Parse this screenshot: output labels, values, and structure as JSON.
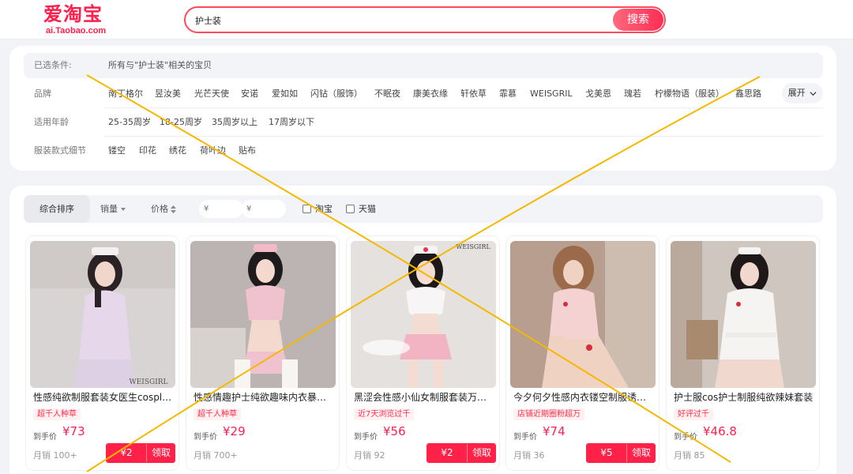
{
  "header": {
    "logo_main": "爱淘宝",
    "logo_sub": "ai.Taobao.com",
    "search_value": "护士装",
    "search_button": "搜索"
  },
  "filters": {
    "selected_label": "已选条件:",
    "selected_value": "所有与\"护士装\"相关的宝贝",
    "brand_label": "品牌",
    "brands": [
      "南丁格尔",
      "昱汝美",
      "光芒天使",
      "安诺",
      "爱如如",
      "闪钻（服饰）",
      "不眠夜",
      "康美衣缘",
      "轩依草",
      "霏慕",
      "WEISGRIL",
      "戈美恩",
      "瑰若",
      "柠檬物语（服装）",
      "鑫思路"
    ],
    "expand_label": "展开",
    "age_label": "适用年龄",
    "ages": [
      "25-35周岁",
      "18-25周岁",
      "35周岁以上",
      "17周岁以下"
    ],
    "detail_label": "服装款式细节",
    "details": [
      "镂空",
      "印花",
      "绣花",
      "荷叶边",
      "贴布"
    ]
  },
  "sort": {
    "comprehensive": "综合排序",
    "sales": "销量",
    "price": "价格",
    "price_min_placeholder": "¥",
    "price_max_placeholder": "¥",
    "dash": "-",
    "taobao": "淘宝",
    "tmall": "天猫"
  },
  "products": [
    {
      "title": "性感纯欲制服套装女医生cosplay护士",
      "tag": "超千人种草",
      "price_label": "到手价",
      "price": "¥73",
      "sales": "月销 100+",
      "coupon": "¥2",
      "coupon_action": "领取",
      "watermark": "WEISGIRL"
    },
    {
      "title": "性感情趣护士纯欲趣味内衣暴露套装",
      "tag": "超千人种草",
      "price_label": "到手价",
      "price": "¥29",
      "sales": "月销 700+"
    },
    {
      "title": "黑涩会性感小仙女制服套装万圣节",
      "tag": "近7天浏览过千",
      "price_label": "到手价",
      "price": "¥56",
      "sales": "月销 92",
      "coupon": "¥2",
      "coupon_action": "领取",
      "watermark": "WEISGIRL"
    },
    {
      "title": "今夕何夕性感内衣镂空制服诱惑护士",
      "tag": "店铺近期圈粉超万",
      "price_label": "到手价",
      "price": "¥74",
      "sales": "月销 36",
      "coupon": "¥5",
      "coupon_action": "领取"
    },
    {
      "title": "护士服cos护士制服纯欲辣妹套装",
      "tag": "好评过千",
      "price_label": "到手价",
      "price": "¥46.8",
      "sales": "月销 85"
    }
  ],
  "colors": {
    "brand": "#ff1f4d",
    "overlay_line": "#f5b800"
  }
}
